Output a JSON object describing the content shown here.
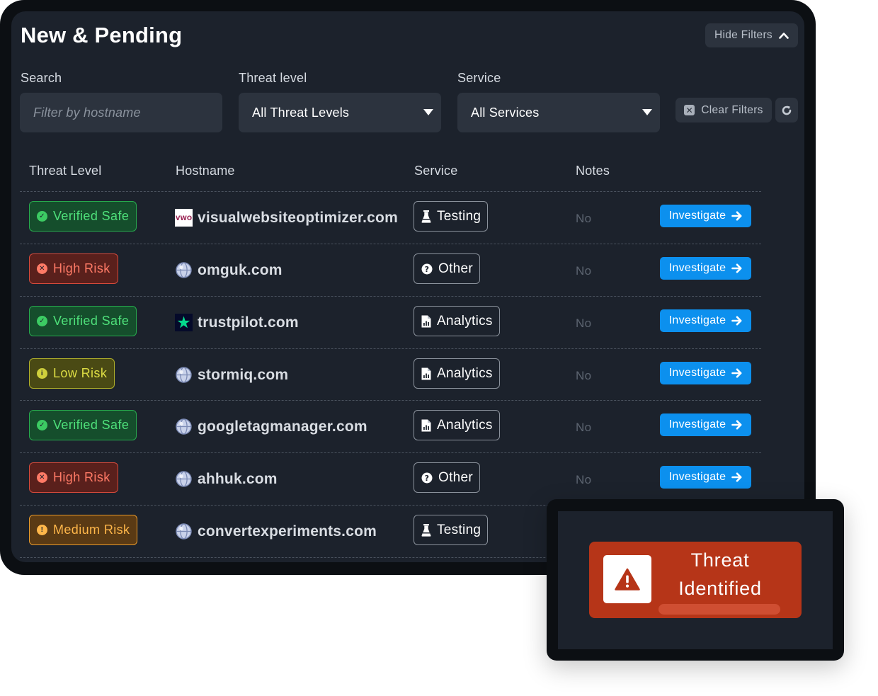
{
  "header": {
    "title": "New & Pending",
    "hide_filters_label": "Hide Filters"
  },
  "filters": {
    "search_label": "Search",
    "search_placeholder": "Filter by hostname",
    "threat_label": "Threat level",
    "threat_value": "All Threat Levels",
    "service_label": "Service",
    "service_value": "All Services",
    "clear_label": "Clear Filters"
  },
  "table": {
    "columns": [
      "Threat Level",
      "Hostname",
      "Service",
      "Notes"
    ],
    "action_label": "Investigate",
    "rows": [
      {
        "level": "Verified Safe",
        "status": "safe",
        "host": "visualwebsiteoptimizer.com",
        "favicon": "vwo-logo-icon",
        "service": "Testing",
        "service_icon": "flask-icon",
        "notes": "No"
      },
      {
        "level": "High Risk",
        "status": "high",
        "host": "omguk.com",
        "favicon": "globe-icon",
        "service": "Other",
        "service_icon": "question-circle-icon",
        "notes": "No"
      },
      {
        "level": "Verified Safe",
        "status": "safe",
        "host": "trustpilot.com",
        "favicon": "trustpilot-star-icon",
        "service": "Analytics",
        "service_icon": "chart-document-icon",
        "notes": "No"
      },
      {
        "level": "Low Risk",
        "status": "low",
        "host": "stormiq.com",
        "favicon": "globe-icon",
        "service": "Analytics",
        "service_icon": "chart-document-icon",
        "notes": "No"
      },
      {
        "level": "Verified Safe",
        "status": "safe",
        "host": "googletagmanager.com",
        "favicon": "globe-icon",
        "service": "Analytics",
        "service_icon": "chart-document-icon",
        "notes": "No"
      },
      {
        "level": "High Risk",
        "status": "high",
        "host": "ahhuk.com",
        "favicon": "globe-icon",
        "service": "Other",
        "service_icon": "question-circle-icon",
        "notes": "No"
      },
      {
        "level": "Medium Risk",
        "status": "medium",
        "host": "convertexperiments.com",
        "favicon": "globe-icon",
        "service": "Testing",
        "service_icon": "flask-icon",
        "notes": ""
      }
    ]
  },
  "alert": {
    "line1": "Threat",
    "line2": "Identified",
    "icon": "warning-triangle-icon"
  },
  "colors": {
    "panel_bg": "#1c222c",
    "accent_blue": "#0c90ee",
    "alert_red": "#b63518",
    "safe": "#3ccb63",
    "high": "#ff7a66",
    "low": "#cfcf3c",
    "medium": "#ffb74a"
  }
}
